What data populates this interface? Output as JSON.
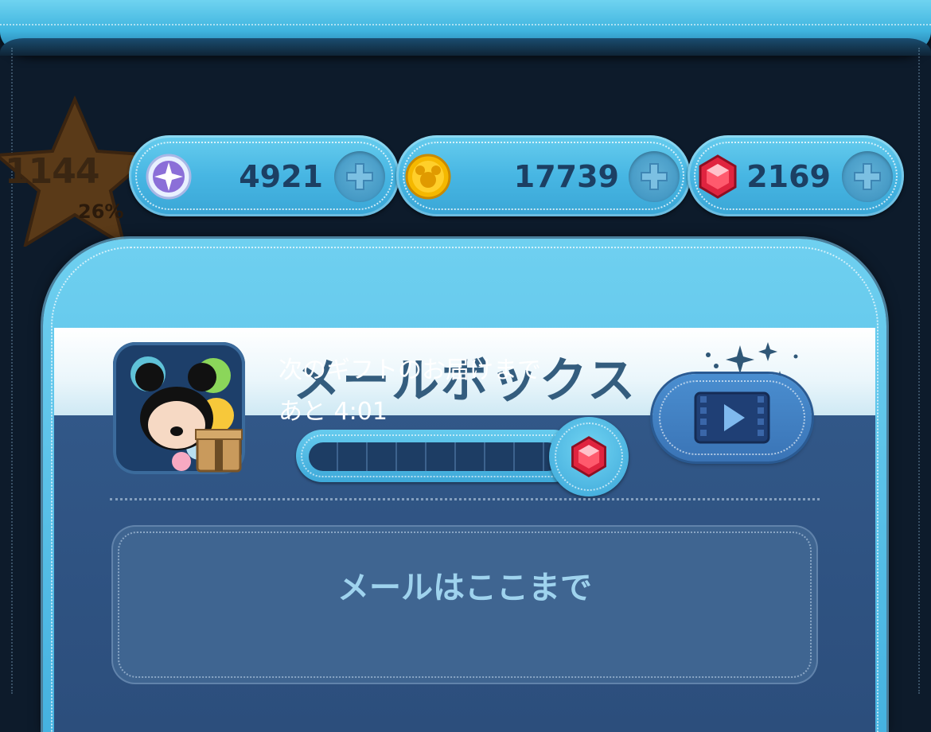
{
  "player": {
    "level": "1144",
    "level_progress": "26%",
    "level_progress_value": 0.26
  },
  "currencies": {
    "skill_tickets": {
      "icon": "star-emblem-icon",
      "value": "4921"
    },
    "coins": {
      "icon": "mickey-coin-icon",
      "value": "17739"
    },
    "rubies": {
      "icon": "ruby-gem-icon",
      "value": "2169"
    }
  },
  "mailbox": {
    "title": "メールボックス",
    "next_gift_line1": "次のギフトのお届けまで",
    "next_gift_line2": "あと 4:01",
    "gift_progress": 0.0,
    "end_of_mail": "メールはここまで"
  },
  "colors": {
    "accent": "#47b6e3",
    "panel": "#2c4e7c",
    "title_text": "#345d7e",
    "ruby": "#e0243f",
    "coin": "#f5b800"
  }
}
